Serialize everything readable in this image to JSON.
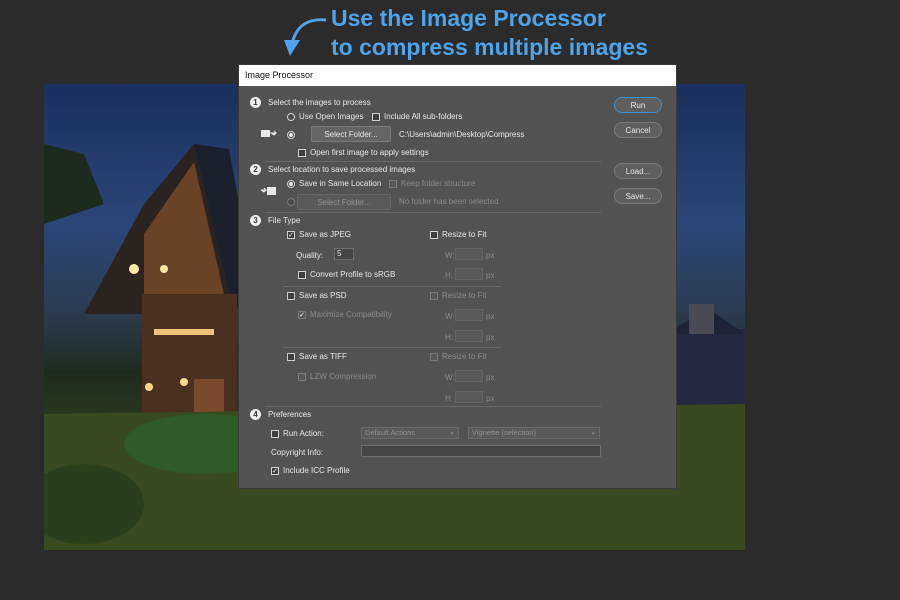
{
  "caption": {
    "line1": "Use the Image Processor",
    "line2": "to compress multiple images",
    "color": "#4ea3ea"
  },
  "dialog": {
    "title": "Image Processor",
    "buttons": {
      "run": "Run",
      "cancel": "Cancel",
      "load": "Load...",
      "save": "Save..."
    },
    "section1": {
      "number": "1",
      "heading": "Select the images to process",
      "use_open_images": "Use Open Images",
      "include_subfolders": "Include All sub-folders",
      "select_folder": "Select Folder...",
      "folder_path": "C:\\Users\\admin\\Desktop\\Compress",
      "open_first_image": "Open first image to apply settings"
    },
    "section2": {
      "number": "2",
      "heading": "Select location to save processed images",
      "save_same_location": "Save in Same Location",
      "keep_folder_structure": "Keep folder structure",
      "select_folder": "Select Folder...",
      "no_folder": "No folder has been selected"
    },
    "section3": {
      "number": "3",
      "heading": "File Type",
      "jpeg": {
        "label": "Save as JPEG",
        "resize": "Resize to Fit",
        "quality_label": "Quality:",
        "quality_value": "5",
        "convert_profile": "Convert Profile to sRGB",
        "w": "W:",
        "h": "H:",
        "px": "px"
      },
      "psd": {
        "label": "Save as PSD",
        "resize": "Resize to Fit",
        "maximize": "Maximize Compatibility",
        "w": "W:",
        "h": "H:",
        "px": "px"
      },
      "tiff": {
        "label": "Save as TIFF",
        "resize": "Resize to Fit",
        "lzw": "LZW Compression",
        "w": "W:",
        "h": "H:",
        "px": "px"
      }
    },
    "section4": {
      "number": "4",
      "heading": "Preferences",
      "run_action": "Run Action:",
      "action_set": "Default Actions",
      "action": "Vignette (selection)",
      "copyright": "Copyright Info:",
      "copyright_value": "",
      "include_icc": "Include ICC Profile"
    }
  }
}
